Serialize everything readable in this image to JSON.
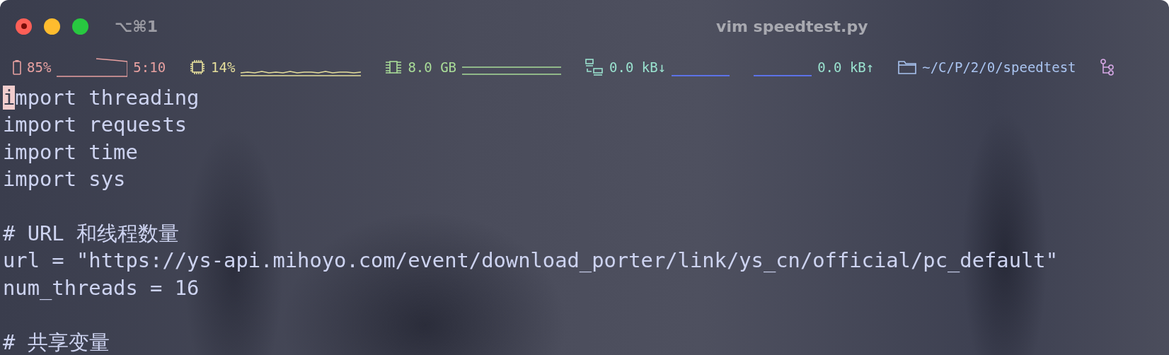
{
  "window": {
    "title": "vim speedtest.py",
    "shortcut": "⌥⌘1"
  },
  "status_bar": [
    {
      "kind": "battery",
      "text": "85%",
      "extra": "5:10",
      "color": "#e8a1a1"
    },
    {
      "kind": "cpu",
      "text": "14%",
      "color": "#e6df9c"
    },
    {
      "kind": "memory",
      "text": "8.0 GB",
      "color": "#a9dc98"
    },
    {
      "kind": "download",
      "text": "0.0 kB↓",
      "color": "#9ae2cf"
    },
    {
      "kind": "upload",
      "text": "0.0 kB↑",
      "color": "#9ae2cf"
    },
    {
      "kind": "path",
      "text": "~/C/P/2/0/speedtest",
      "color": "#a9c3ef"
    },
    {
      "kind": "branch",
      "color": "#d7a8e6"
    }
  ],
  "lines": [
    {
      "text": "import threading",
      "cursor": true
    },
    {
      "text": "import requests",
      "cursor": false
    },
    {
      "text": "import time",
      "cursor": false
    },
    {
      "text": "import sys",
      "cursor": false
    },
    {
      "kind": "blank"
    },
    {
      "text": "# URL 和线程数量",
      "cursor": false
    },
    {
      "text": "url = \"https://ys-api.mihoyo.com/event/download_porter/link/ys_cn/official/pc_default\"",
      "cursor": false
    },
    {
      "text": "num_threads = 16",
      "cursor": false
    },
    {
      "kind": "blank"
    },
    {
      "text": "# 共享变量",
      "cursor": false
    }
  ]
}
